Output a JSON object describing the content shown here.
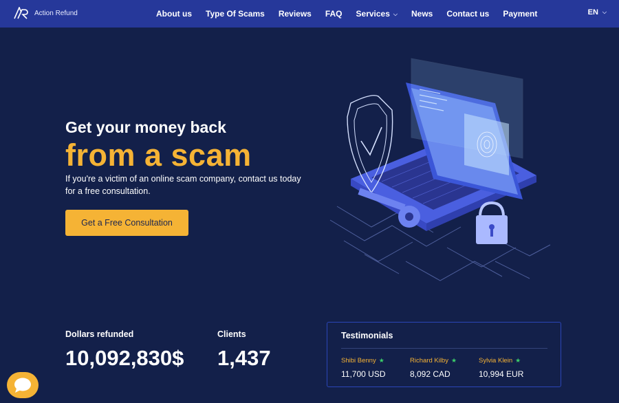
{
  "brand": {
    "name": "Action Refund",
    "logo_icon": "ar-logo-icon"
  },
  "nav": {
    "items": [
      {
        "label": "About us",
        "has_dropdown": false
      },
      {
        "label": "Type Of Scams",
        "has_dropdown": false
      },
      {
        "label": "Reviews",
        "has_dropdown": false
      },
      {
        "label": "FAQ",
        "has_dropdown": false
      },
      {
        "label": "Services",
        "has_dropdown": true
      },
      {
        "label": "News",
        "has_dropdown": false
      },
      {
        "label": "Contact us",
        "has_dropdown": false
      },
      {
        "label": "Payment",
        "has_dropdown": false
      }
    ],
    "language": "EN"
  },
  "hero": {
    "line1": "Get your money back",
    "line2": "from a scam",
    "description": "If you're a victim of an online scam company, contact us today for a free consultation.",
    "cta_label": "Get a Free Consultation",
    "illustration_icon": "laptop-security-illustration"
  },
  "stats": {
    "dollars_label": "Dollars refunded",
    "dollars_value": "10,092,830$",
    "clients_label": "Clients",
    "clients_value": "1,437"
  },
  "testimonials": {
    "title": "Testimonials",
    "items": [
      {
        "name": "Shibi Benny",
        "amount": "11,700 USD"
      },
      {
        "name": "Richard Kilby",
        "amount": "8,092 CAD"
      },
      {
        "name": "Sylvia Klein",
        "amount": "10,994 EUR"
      }
    ]
  },
  "colors": {
    "background": "#13204a",
    "nav": "#26389a",
    "accent": "#f5b335",
    "verified": "#3ccf6b"
  },
  "chat": {
    "icon": "chat-bubble-icon"
  }
}
